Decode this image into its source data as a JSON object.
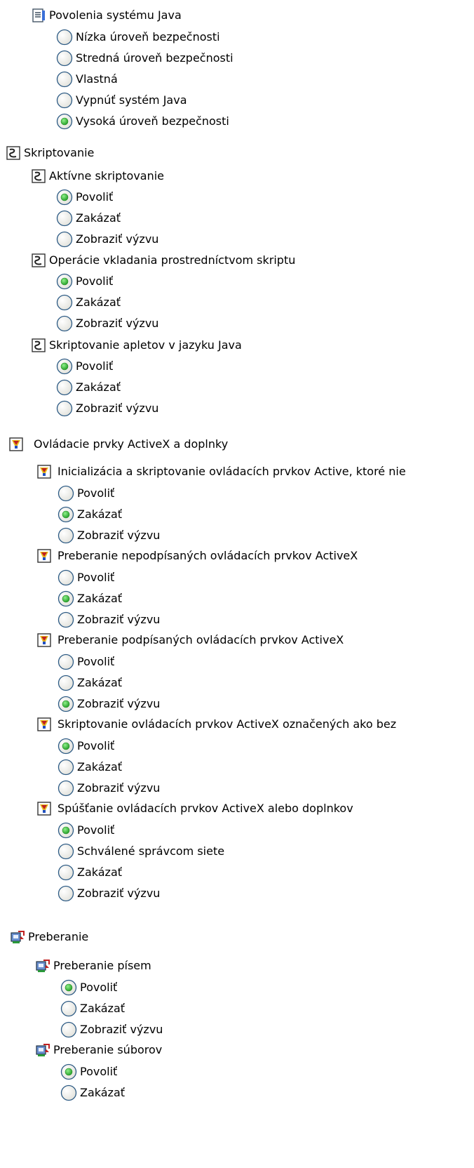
{
  "java": {
    "title": "Povolenia systému Java",
    "icon": "document-list-icon",
    "options": [
      {
        "label": "Nízka úroveň bezpečnosti",
        "checked": false
      },
      {
        "label": "Stredná úroveň bezpečnosti",
        "checked": false
      },
      {
        "label": "Vlastná",
        "checked": false
      },
      {
        "label": "Vypnúť systém Java",
        "checked": false
      },
      {
        "label": "Vysoká úroveň bezpečnosti",
        "checked": true
      }
    ]
  },
  "scripting": {
    "title": "Skriptovanie",
    "icon": "script-icon",
    "settings": [
      {
        "title": "Aktívne skriptovanie",
        "options": [
          {
            "label": "Povoliť",
            "checked": true
          },
          {
            "label": "Zakázať",
            "checked": false
          },
          {
            "label": "Zobraziť výzvu",
            "checked": false
          }
        ]
      },
      {
        "title": "Operácie vkladania prostredníctvom skriptu",
        "options": [
          {
            "label": "Povoliť",
            "checked": true
          },
          {
            "label": "Zakázať",
            "checked": false
          },
          {
            "label": "Zobraziť výzvu",
            "checked": false
          }
        ]
      },
      {
        "title": "Skriptovanie apletov v jazyku Java",
        "options": [
          {
            "label": "Povoliť",
            "checked": true
          },
          {
            "label": "Zakázať",
            "checked": false
          },
          {
            "label": "Zobraziť výzvu",
            "checked": false
          }
        ]
      }
    ]
  },
  "activex": {
    "title": "Ovládacie prvky ActiveX a doplnky",
    "icon": "activex-icon",
    "settings": [
      {
        "title": "Inicializácia a skriptovanie ovládacích prvkov Active, ktoré nie",
        "options": [
          {
            "label": "Povoliť",
            "checked": false
          },
          {
            "label": "Zakázať",
            "checked": true
          },
          {
            "label": "Zobraziť výzvu",
            "checked": false
          }
        ]
      },
      {
        "title": "Preberanie nepodpísaných ovládacích prvkov ActiveX",
        "options": [
          {
            "label": "Povoliť",
            "checked": false
          },
          {
            "label": "Zakázať",
            "checked": true
          },
          {
            "label": "Zobraziť výzvu",
            "checked": false
          }
        ]
      },
      {
        "title": "Preberanie podpísaných ovládacích prvkov ActiveX",
        "options": [
          {
            "label": "Povoliť",
            "checked": false
          },
          {
            "label": "Zakázať",
            "checked": false
          },
          {
            "label": "Zobraziť výzvu",
            "checked": true
          }
        ]
      },
      {
        "title": "Skriptovanie ovládacích prvkov ActiveX označených ako bez",
        "options": [
          {
            "label": "Povoliť",
            "checked": true
          },
          {
            "label": "Zakázať",
            "checked": false
          },
          {
            "label": "Zobraziť výzvu",
            "checked": false
          }
        ]
      },
      {
        "title": "Spúšťanie ovládacích prvkov ActiveX alebo doplnkov",
        "options": [
          {
            "label": "Povoliť",
            "checked": true
          },
          {
            "label": "Schválené správcom siete",
            "checked": false
          },
          {
            "label": "Zakázať",
            "checked": false
          },
          {
            "label": "Zobraziť výzvu",
            "checked": false
          }
        ]
      }
    ]
  },
  "downloads": {
    "title": "Preberanie",
    "icon": "download-icon",
    "settings": [
      {
        "title": "Preberanie písem",
        "options": [
          {
            "label": "Povoliť",
            "checked": true
          },
          {
            "label": "Zakázať",
            "checked": false
          },
          {
            "label": "Zobraziť výzvu",
            "checked": false
          }
        ]
      },
      {
        "title": "Preberanie súborov",
        "options": [
          {
            "label": "Povoliť",
            "checked": true
          },
          {
            "label": "Zakázať",
            "checked": false
          }
        ]
      }
    ]
  }
}
